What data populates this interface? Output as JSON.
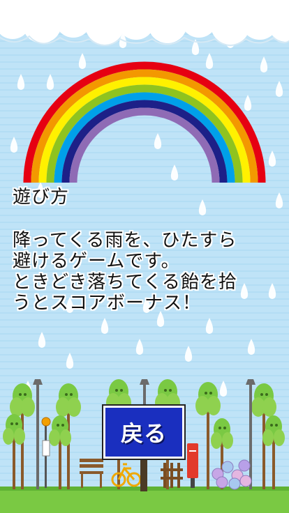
{
  "screen": "how-to-play",
  "howto": {
    "title": "遊び方",
    "lines": [
      "降ってくる雨を、ひたすら",
      "避けるゲームです。",
      "ときどき落ちてくる飴を拾",
      "うとスコアボーナス！"
    ]
  },
  "back_button": {
    "label": "戻る"
  },
  "colors": {
    "sky": "#bfe3f7",
    "raindrop": "#ffffff",
    "button": "#1a2fbf",
    "grass": "#7ac943",
    "rainbow": [
      "#e60012",
      "#f39800",
      "#fff100",
      "#8fc31f",
      "#00a0e9",
      "#1d2088",
      "#8f6bb5"
    ]
  },
  "icons": [
    "cloud-icon",
    "raindrop-icon",
    "rainbow-icon",
    "tree-icon",
    "street-lamp-icon",
    "bench-icon",
    "bicycle-icon",
    "mailbox-icon",
    "hydrangea-icon",
    "bus-stop-sign-icon"
  ]
}
